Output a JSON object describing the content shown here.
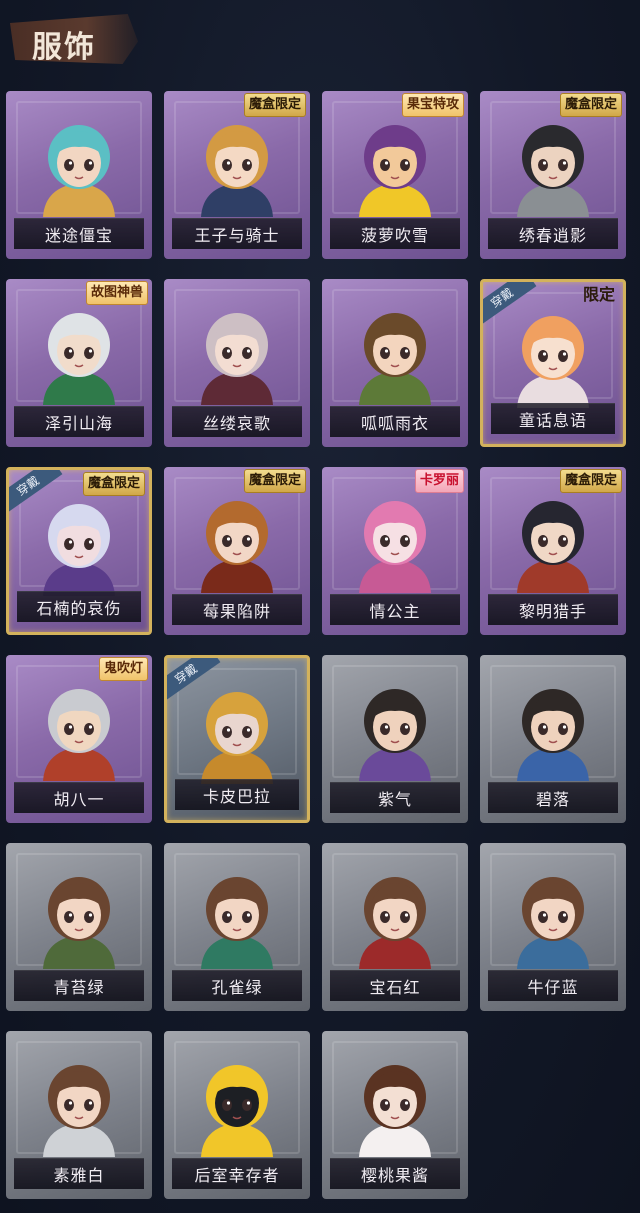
{
  "header": {
    "title": "服饰"
  },
  "wear_tag": "穿戴",
  "items": [
    {
      "label": "迷途僵宝",
      "style": "purple",
      "badge": "",
      "equipped": false,
      "hair": "#5bbfc4",
      "skin": "#f2d6c2",
      "cloth": "#d9a64a"
    },
    {
      "label": "王子与骑士",
      "style": "purple",
      "badge": "魔盒限定",
      "badge_style": "gold",
      "equipped": false,
      "hair": "#d39a43",
      "skin": "#f4d9c4",
      "cloth": "#2f3f66"
    },
    {
      "label": "菠萝吹雪",
      "style": "purple",
      "badge": "果宝特攻",
      "badge_style": "game",
      "equipped": false,
      "hair": "#6e3c8a",
      "skin": "#f2c99a",
      "cloth": "#f0c728"
    },
    {
      "label": "绣春逍影",
      "style": "purple",
      "badge": "魔盒限定",
      "badge_style": "gold",
      "equipped": false,
      "hair": "#2a2a2e",
      "skin": "#ecd3c0",
      "cloth": "#8a8f93"
    },
    {
      "label": "泽引山海",
      "style": "purple",
      "badge": "故图神兽",
      "badge_style": "game",
      "equipped": false,
      "hair": "#dfe3e6",
      "skin": "#f1dccb",
      "cloth": "#2f7a4a"
    },
    {
      "label": "丝缕哀歌",
      "style": "purple",
      "badge": "",
      "equipped": false,
      "hair": "#cdbfc4",
      "skin": "#f3ddd2",
      "cloth": "#5e2a36"
    },
    {
      "label": "呱呱雨衣",
      "style": "purple",
      "badge": "",
      "equipped": false,
      "hair": "#6a4a2a",
      "skin": "#f3d5be",
      "cloth": "#5d7a38"
    },
    {
      "label": "童话息语",
      "style": "purple",
      "badge": "限定",
      "badge_style": "plain",
      "equipped": true,
      "hair": "#f0a060",
      "skin": "#f7e0cf",
      "cloth": "#e9dde0"
    },
    {
      "label": "石楠的哀伤",
      "style": "purple",
      "badge": "魔盒限定",
      "badge_style": "gold",
      "equipped": true,
      "hair": "#d6d9ef",
      "skin": "#f1dde0",
      "cloth": "#5a3c8a"
    },
    {
      "label": "莓果陷阱",
      "style": "purple",
      "badge": "魔盒限定",
      "badge_style": "gold",
      "equipped": false,
      "hair": "#b36a2e",
      "skin": "#f2d7c6",
      "cloth": "#7a2a1a"
    },
    {
      "label": "情公主",
      "style": "purple",
      "badge": "卡罗丽",
      "badge_style": "red",
      "equipped": false,
      "hair": "#e27ab0",
      "skin": "#f6e0e4",
      "cloth": "#c75a95"
    },
    {
      "label": "黎明猎手",
      "style": "purple",
      "badge": "魔盒限定",
      "badge_style": "gold",
      "equipped": false,
      "hair": "#262630",
      "skin": "#f0d8c6",
      "cloth": "#a03a2a"
    },
    {
      "label": "胡八一",
      "style": "purple",
      "badge": "鬼吹灯",
      "badge_style": "game",
      "equipped": false,
      "hair": "#c9cbd0",
      "skin": "#f0d7c0",
      "cloth": "#b0402a"
    },
    {
      "label": "卡皮巴拉",
      "style": "gray",
      "badge": "",
      "equipped": true,
      "hair": "#d7a23c",
      "skin": "#e9d6cf",
      "cloth": "#c68a2c"
    },
    {
      "label": "紫气",
      "style": "gray",
      "badge": "",
      "equipped": false,
      "hair": "#2e2826",
      "skin": "#efd2bd",
      "cloth": "#6a4a9a"
    },
    {
      "label": "碧落",
      "style": "gray",
      "badge": "",
      "equipped": false,
      "hair": "#2e2826",
      "skin": "#efd2bd",
      "cloth": "#3a64a8"
    },
    {
      "label": "青苔绿",
      "style": "gray",
      "badge": "",
      "equipped": false,
      "hair": "#6a4530",
      "skin": "#f2d6c4",
      "cloth": "#4f6a3a"
    },
    {
      "label": "孔雀绿",
      "style": "gray",
      "badge": "",
      "equipped": false,
      "hair": "#6a4530",
      "skin": "#f2d6c4",
      "cloth": "#2f7a62"
    },
    {
      "label": "宝石红",
      "style": "gray",
      "badge": "",
      "equipped": false,
      "hair": "#6a4530",
      "skin": "#f2d6c4",
      "cloth": "#9c2a2a"
    },
    {
      "label": "牛仔蓝",
      "style": "gray",
      "badge": "",
      "equipped": false,
      "hair": "#6a4530",
      "skin": "#f2d6c4",
      "cloth": "#3b6d9c"
    },
    {
      "label": "素雅白",
      "style": "gray",
      "badge": "",
      "equipped": false,
      "hair": "#6a4530",
      "skin": "#f2d6c4",
      "cloth": "#cfd2d6"
    },
    {
      "label": "后室幸存者",
      "style": "gray",
      "badge": "",
      "equipped": false,
      "hair": "#f1c629",
      "skin": "#1d1f24",
      "cloth": "#f1c629"
    },
    {
      "label": "樱桃果酱",
      "style": "gray",
      "badge": "",
      "equipped": false,
      "hair": "#5a3322",
      "skin": "#f3dfd3",
      "cloth": "#f4f0f0"
    }
  ]
}
